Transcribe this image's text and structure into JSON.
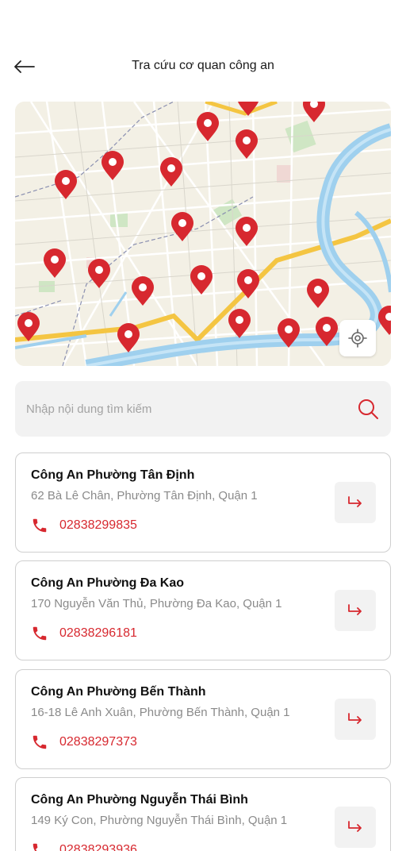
{
  "header": {
    "title": "Tra cứu cơ quan công an",
    "back_icon": "arrow-left-icon"
  },
  "map": {
    "pin_icon": "map-pin-icon",
    "locate_icon": "crosshair-icon",
    "accent": "#d7282f"
  },
  "search": {
    "placeholder": "Nhập nội dung tìm kiếm",
    "value": "",
    "icon": "search-icon"
  },
  "stations": [
    {
      "name": "Công An Phường Tân Định",
      "address": "62 Bà Lê Chân, Phường Tân Định, Quận 1",
      "phone": "02838299835"
    },
    {
      "name": "Công An Phường Đa Kao",
      "address": "170 Nguyễn Văn Thủ, Phường Đa Kao, Quận 1",
      "phone": "02838296181"
    },
    {
      "name": "Công An Phường Bến Thành",
      "address": "16-18 Lê Anh Xuân, Phường Bến Thành, Quận 1",
      "phone": "02838297373"
    },
    {
      "name": "Công An Phường Nguyễn Thái Bình",
      "address": "149 Ký Con, Phường Nguyễn Thái Bình, Quận 1",
      "phone": "02838293936"
    }
  ]
}
